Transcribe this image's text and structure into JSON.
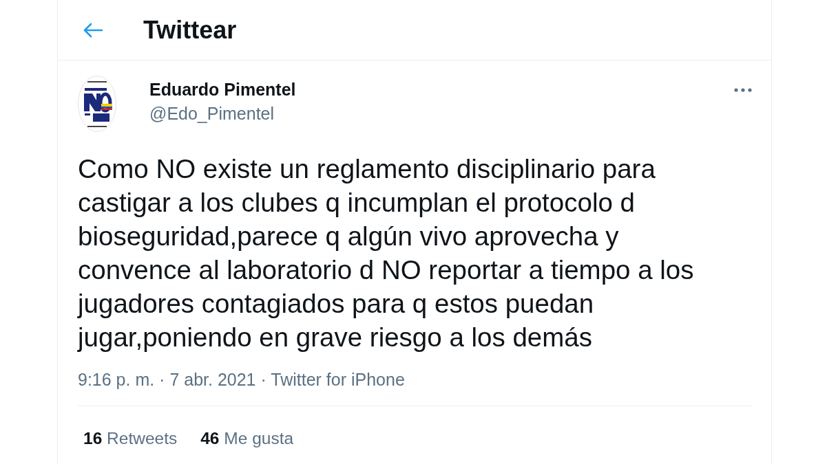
{
  "header": {
    "title": "Twittear"
  },
  "tweet": {
    "author": {
      "name": "Eduardo Pimentel",
      "handle": "@Edo_Pimentel"
    },
    "text": "Como NO existe un reglamento disciplinario para castigar a los clubes q incumplan el protocolo d bioseguridad,parece q algún vivo aprovecha y convence al laboratorio d NO reportar a tiempo a los jugadores contagiados para q estos puedan jugar,poniendo en grave riesgo a los demás",
    "meta": "9:16 p. m. · 7 abr. 2021 · Twitter for iPhone",
    "stats": [
      {
        "count": "16",
        "label": "Retweets"
      },
      {
        "count": "46",
        "label": "Me gusta"
      }
    ]
  }
}
